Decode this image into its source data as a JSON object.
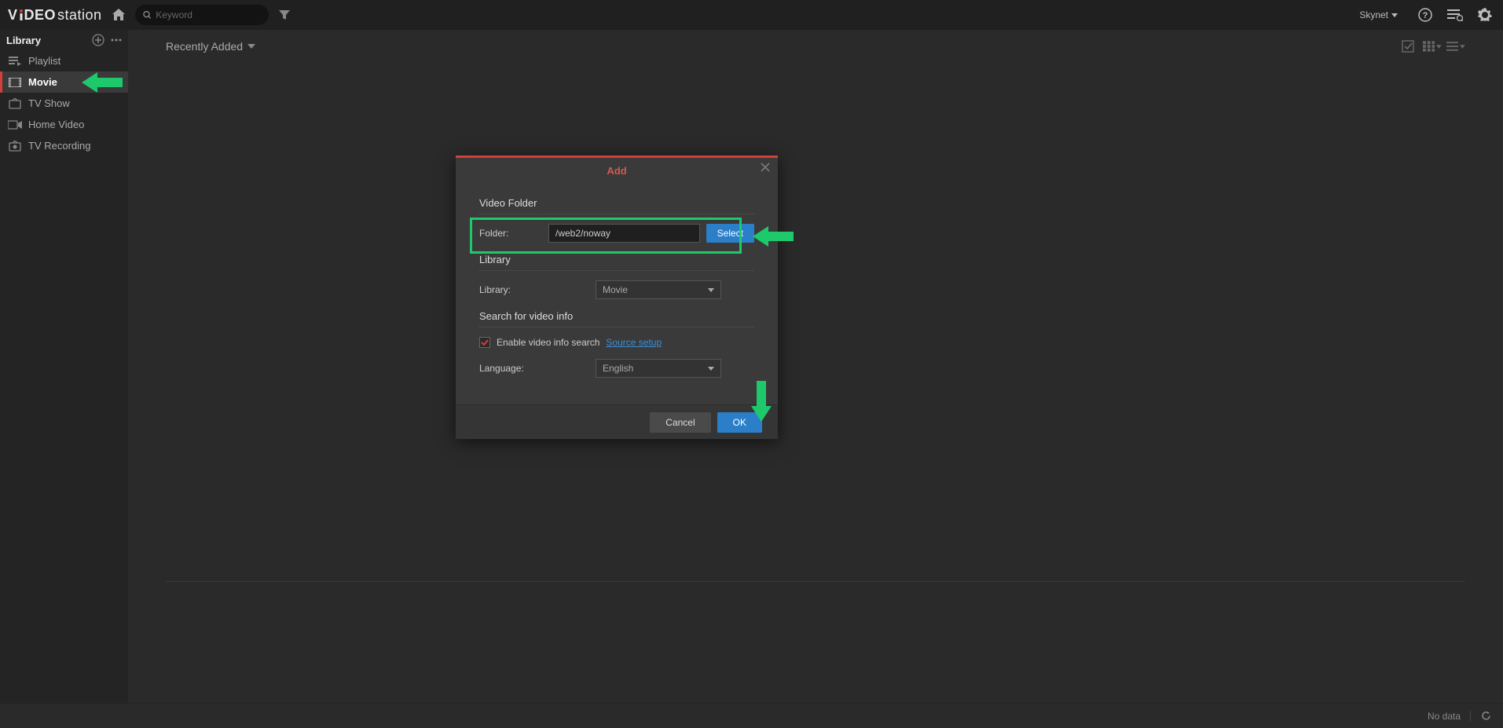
{
  "app": {
    "name_part1": "V",
    "name_part2": "DEO",
    "name_part3": "station"
  },
  "topbar": {
    "search_placeholder": "Keyword",
    "user": "Skynet"
  },
  "sidebar": {
    "title": "Library",
    "items": [
      {
        "label": "Playlist"
      },
      {
        "label": "Movie"
      },
      {
        "label": "TV Show"
      },
      {
        "label": "Home Video"
      },
      {
        "label": "TV Recording"
      }
    ]
  },
  "content": {
    "sort_label": "Recently Added"
  },
  "footer": {
    "status": "No data"
  },
  "modal": {
    "title": "Add",
    "section_video_folder": "Video Folder",
    "folder_label": "Folder:",
    "folder_value": "/web2/noway",
    "select_btn": "Select",
    "section_library": "Library",
    "library_label": "Library:",
    "library_value": "Movie",
    "section_search": "Search for video info",
    "enable_search_label": "Enable video info search",
    "source_setup": "Source setup",
    "language_label": "Language:",
    "language_value": "English",
    "cancel": "Cancel",
    "ok": "OK"
  }
}
